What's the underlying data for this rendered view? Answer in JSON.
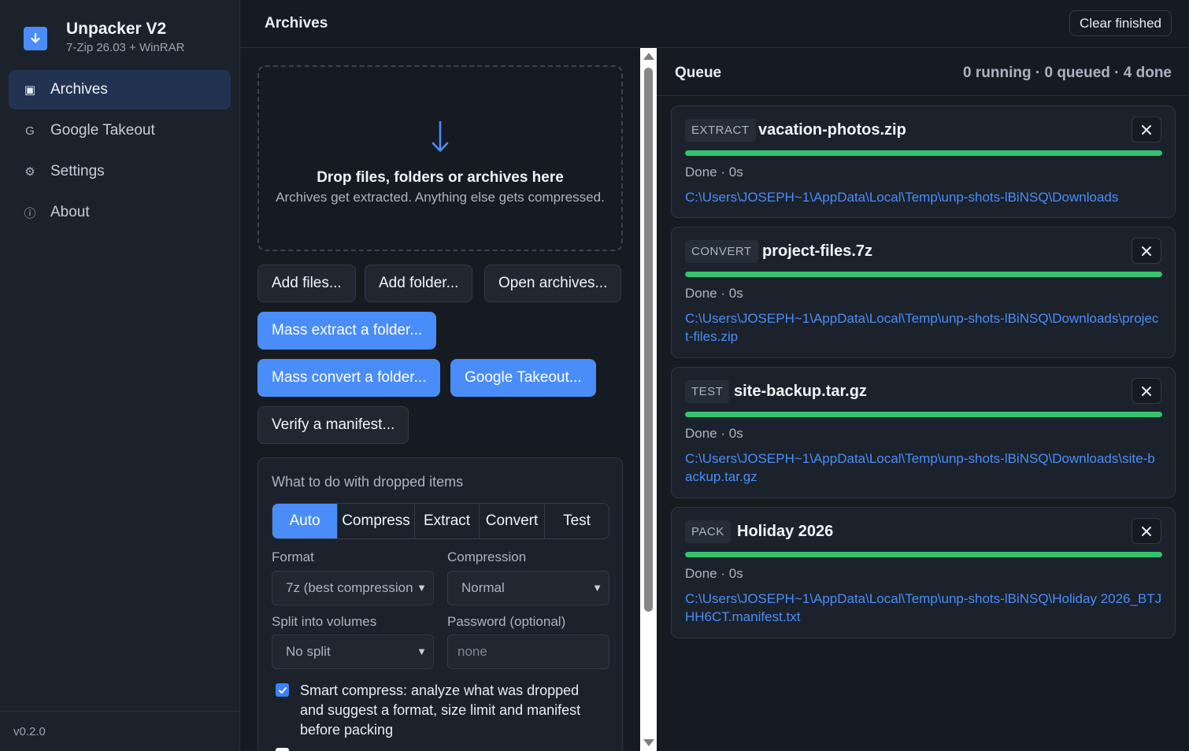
{
  "app": {
    "title": "Unpacker V2",
    "subtitle": "7-Zip 26.03 + WinRAR",
    "version": "v0.2.0"
  },
  "sidebar": {
    "items": [
      {
        "label": "Archives",
        "icon": "archive-icon",
        "glyph": "▣",
        "active": true
      },
      {
        "label": "Google Takeout",
        "icon": "google-icon",
        "glyph": "G",
        "active": false
      },
      {
        "label": "Settings",
        "icon": "gear-icon",
        "glyph": "⚙",
        "active": false
      },
      {
        "label": "About",
        "icon": "info-icon",
        "glyph": "ⓘ",
        "active": false
      }
    ]
  },
  "header": {
    "title": "Archives",
    "clear_label": "Clear finished"
  },
  "dropzone": {
    "title": "Drop files, folders or archives here",
    "subtitle": "Archives get extracted. Anything else gets compressed."
  },
  "actions": {
    "add_files": "Add files...",
    "add_folder": "Add folder...",
    "open_archives": "Open archives...",
    "mass_extract": "Mass extract a folder...",
    "mass_convert": "Mass convert a folder...",
    "google_takeout": "Google Takeout...",
    "verify_manifest": "Verify a manifest..."
  },
  "options": {
    "title": "What to do with dropped items",
    "modes": [
      "Auto",
      "Compress",
      "Extract",
      "Convert",
      "Test"
    ],
    "active_mode": "Auto",
    "format_label": "Format",
    "format_value": "7z (best compression",
    "compression_label": "Compression",
    "compression_value": "Normal",
    "split_label": "Split into volumes",
    "split_value": "No split",
    "password_label": "Password (optional)",
    "password_placeholder": "none",
    "smart_compress_label": "Smart compress: analyze what was dropped and suggest a format, size limit and manifest before packing",
    "smart_compress_checked": true
  },
  "queue": {
    "title": "Queue",
    "stats": "0 running · 0 queued · 4 done",
    "jobs": [
      {
        "tag": "EXTRACT",
        "name": "vacation-photos.zip",
        "progress": 1.0,
        "status": "Done · 0s",
        "path": "C:\\Users\\JOSEPH~1\\AppData\\Local\\Temp\\unp-shots-lBiNSQ\\Downloads"
      },
      {
        "tag": "CONVERT",
        "name": "project-files.7z",
        "progress": 1.0,
        "status": "Done · 0s",
        "path": "C:\\Users\\JOSEPH~1\\AppData\\Local\\Temp\\unp-shots-lBiNSQ\\Downloads\\project-files.zip"
      },
      {
        "tag": "TEST",
        "name": "site-backup.tar.gz",
        "progress": 1.0,
        "status": "Done · 0s",
        "path": "C:\\Users\\JOSEPH~1\\AppData\\Local\\Temp\\unp-shots-lBiNSQ\\Downloads\\site-backup.tar.gz"
      },
      {
        "tag": "PACK",
        "name": "Holiday 2026",
        "progress": 1.0,
        "status": "Done · 0s",
        "path": "C:\\Users\\JOSEPH~1\\AppData\\Local\\Temp\\unp-shots-lBiNSQ\\Holiday 2026_BTJHH6CT.manifest.txt"
      }
    ]
  },
  "colors": {
    "accent": "#4a8df8",
    "success": "#35c46e",
    "background": "#161b22",
    "sidebar": "#1b222c"
  }
}
